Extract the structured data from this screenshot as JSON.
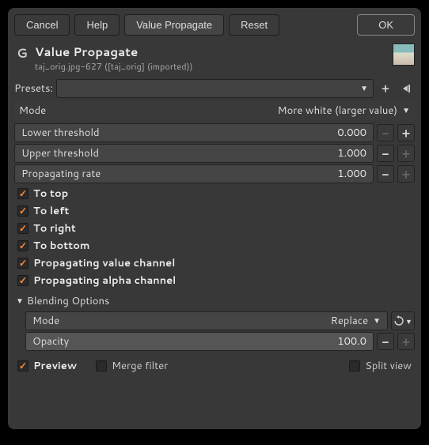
{
  "buttons": {
    "cancel": "Cancel",
    "help": "Help",
    "title": "Value Propagate",
    "reset": "Reset",
    "ok": "OK"
  },
  "header": {
    "title": "Value Propagate",
    "subtitle": "taj_orig.jpg-627 ([taj_orig] (imported))"
  },
  "presets": {
    "label": "Presets:"
  },
  "mode": {
    "label": "Mode",
    "value": "More white (larger value)"
  },
  "lower": {
    "label": "Lower threshold",
    "value": "0.000"
  },
  "upper": {
    "label": "Upper threshold",
    "value": "1.000"
  },
  "rate": {
    "label": "Propagating rate",
    "value": "1.000"
  },
  "checks": {
    "top": "To top",
    "left": "To left",
    "right": "To right",
    "bottom": "To bottom",
    "valch": "Propagating value channel",
    "alphach": "Propagating alpha channel"
  },
  "blending": {
    "section": "Blending Options",
    "mode_label": "Mode",
    "mode_value": "Replace",
    "opacity_label": "Opacity",
    "opacity_value": "100.0"
  },
  "footer": {
    "preview": "Preview",
    "merge": "Merge filter",
    "split": "Split view"
  }
}
